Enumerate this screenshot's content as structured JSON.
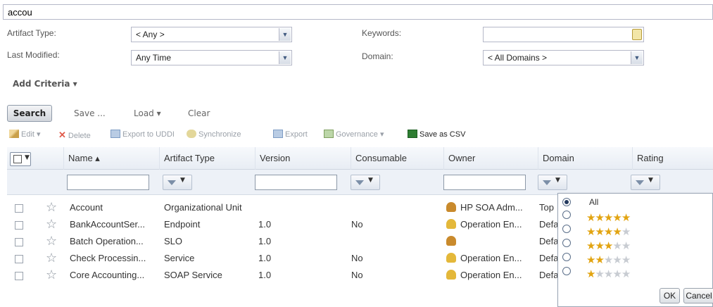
{
  "search": {
    "query": "accou"
  },
  "filters": {
    "artifact_type_label": "Artifact Type:",
    "artifact_type_value": "< Any >",
    "last_modified_label": "Last Modified:",
    "last_modified_value": "Any Time",
    "keywords_label": "Keywords:",
    "keywords_value": "",
    "domain_label": "Domain:",
    "domain_value": "< All Domains >"
  },
  "add_criteria": "Add Criteria ▾",
  "actions": {
    "search": "Search",
    "save": "Save ...",
    "load": "Load ▾",
    "clear": "Clear"
  },
  "toolbar": {
    "edit": "Edit",
    "delete": "Delete",
    "export_uddi": "Export to UDDI",
    "synchronize": "Synchronize",
    "export": "Export",
    "governance": "Governance",
    "save_csv": "Save as CSV"
  },
  "columns": {
    "name": "Name ▴",
    "artifact_type": "Artifact Type",
    "version": "Version",
    "consumable": "Consumable",
    "owner": "Owner",
    "domain": "Domain",
    "rating": "Rating"
  },
  "rows": [
    {
      "name": "Account",
      "type": "Organizational Unit",
      "version": "",
      "consumable": "",
      "owner": "HP SOA Adm...",
      "domain": "Top"
    },
    {
      "name": "BankAccountSer...",
      "type": "Endpoint",
      "version": "1.0",
      "consumable": "No",
      "owner": "Operation En...",
      "domain": "Defa"
    },
    {
      "name": "Batch Operation...",
      "type": "SLO",
      "version": "1.0",
      "consumable": "",
      "owner": "",
      "domain": "Defa"
    },
    {
      "name": "Check Processin...",
      "type": "Service",
      "version": "1.0",
      "consumable": "No",
      "owner": "Operation En...",
      "domain": "Defa"
    },
    {
      "name": "Core Accounting...",
      "type": "SOAP Service",
      "version": "1.0",
      "consumable": "No",
      "owner": "Operation En...",
      "domain": "Defa"
    }
  ],
  "rating_popup": {
    "all_label": "All",
    "options_stars": [
      5,
      4,
      3,
      2,
      1
    ],
    "ok": "OK",
    "cancel": "Cancel"
  },
  "colors": {
    "star_fill": "#e2a411",
    "star_empty": "#c8ccd2",
    "header_bg": "#e8edf4"
  }
}
